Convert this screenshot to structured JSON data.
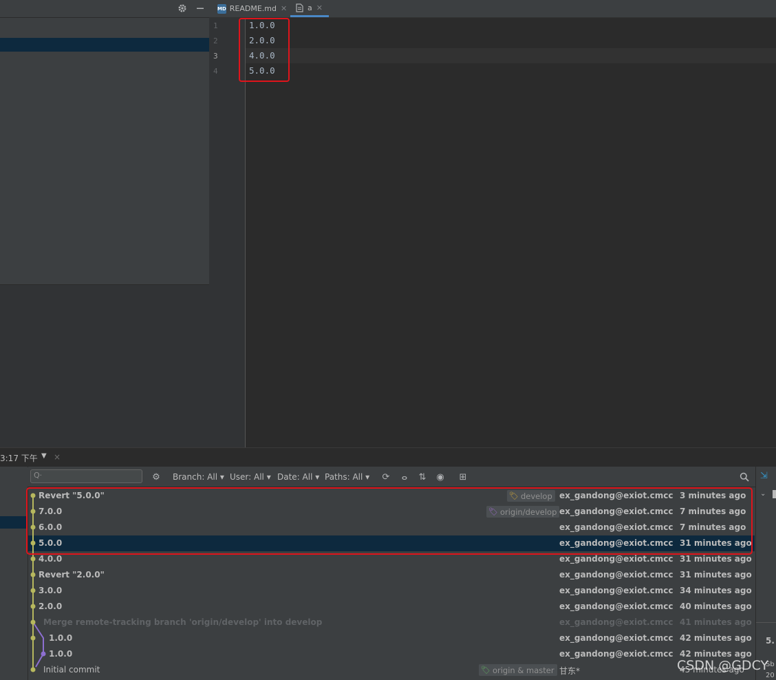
{
  "editor": {
    "tabs": [
      {
        "label": "README.md",
        "icon": "markdown-file-icon",
        "active": false
      },
      {
        "label": "a",
        "icon": "text-file-icon",
        "active": true
      }
    ],
    "lines": [
      {
        "num": "1",
        "text": "1.0.0"
      },
      {
        "num": "2",
        "text": "2.0.0"
      },
      {
        "num": "3",
        "text": "4.0.0"
      },
      {
        "num": "4",
        "text": "5.0.0"
      }
    ]
  },
  "tool_window": {
    "title": "3:17 下午",
    "close": "×"
  },
  "log": {
    "search_placeholder": "Q·",
    "filters": {
      "branch": "Branch: All ▾",
      "user": "User: All ▾",
      "date": "Date: All ▾",
      "paths": "Paths: All ▾"
    },
    "commits": [
      {
        "subject": "Revert \"5.0.0\"",
        "ref": "develop",
        "author": "ex_gandong@exiot.cmcc",
        "date": "3 minutes ago"
      },
      {
        "subject": "7.0.0",
        "ref": "origin/develop",
        "author": "ex_gandong@exiot.cmcc",
        "date": "7 minutes ago"
      },
      {
        "subject": "6.0.0",
        "ref": "",
        "author": "ex_gandong@exiot.cmcc",
        "date": "7 minutes ago"
      },
      {
        "subject": "5.0.0",
        "ref": "",
        "author": "ex_gandong@exiot.cmcc",
        "date": "31 minutes ago"
      },
      {
        "subject": "4.0.0",
        "ref": "",
        "author": "ex_gandong@exiot.cmcc",
        "date": "31 minutes ago"
      },
      {
        "subject": "Revert \"2.0.0\"",
        "ref": "",
        "author": "ex_gandong@exiot.cmcc",
        "date": "31 minutes ago"
      },
      {
        "subject": "3.0.0",
        "ref": "",
        "author": "ex_gandong@exiot.cmcc",
        "date": "34 minutes ago"
      },
      {
        "subject": "2.0.0",
        "ref": "",
        "author": "ex_gandong@exiot.cmcc",
        "date": "40 minutes ago"
      },
      {
        "subject": "Merge remote-tracking branch 'origin/develop' into develop",
        "ref": "",
        "author": "ex_gandong@exiot.cmcc",
        "date": "41 minutes ago"
      },
      {
        "subject": "1.0.0",
        "ref": "",
        "author": "ex_gandong@exiot.cmcc",
        "date": "42 minutes ago"
      },
      {
        "subject": "1.0.0",
        "ref": "",
        "author": "ex_gandong@exiot.cmcc",
        "date": "42 minutes ago"
      },
      {
        "subject": "Initial commit",
        "ref": "origin & master",
        "author": "甘东*",
        "date": "45 minutes ago"
      }
    ],
    "selected_index": 3
  },
  "details": {
    "line1": "5.",
    "line2": "Sb",
    "line3": "20"
  },
  "watermark": "CSDN @GDCY",
  "colors": {
    "highlight_border": "#e0141b",
    "selection": "#0d293e",
    "graph_main": "#b7b85e",
    "graph_branch": "#8d6fd1"
  }
}
